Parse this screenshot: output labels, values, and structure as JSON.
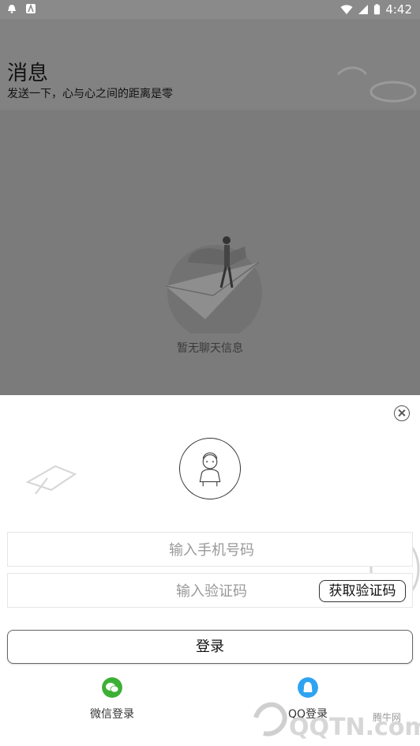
{
  "status_bar": {
    "time": "4:42"
  },
  "page": {
    "title": "消息",
    "subtitle": "发送一下，心与心之间的距离是零",
    "empty_text": "暂无聊天信息"
  },
  "login_sheet": {
    "phone_placeholder": "输入手机号码",
    "code_placeholder": "输入验证码",
    "get_code_label": "获取验证码",
    "login_label": "登录",
    "wechat_label": "微信登录",
    "qq_label": "QQ登录"
  },
  "colors": {
    "wechat": "#3cb035",
    "qq": "#2ea3f2"
  },
  "watermark": {
    "text": "QQTN.com",
    "small_text": "腾牛网"
  }
}
